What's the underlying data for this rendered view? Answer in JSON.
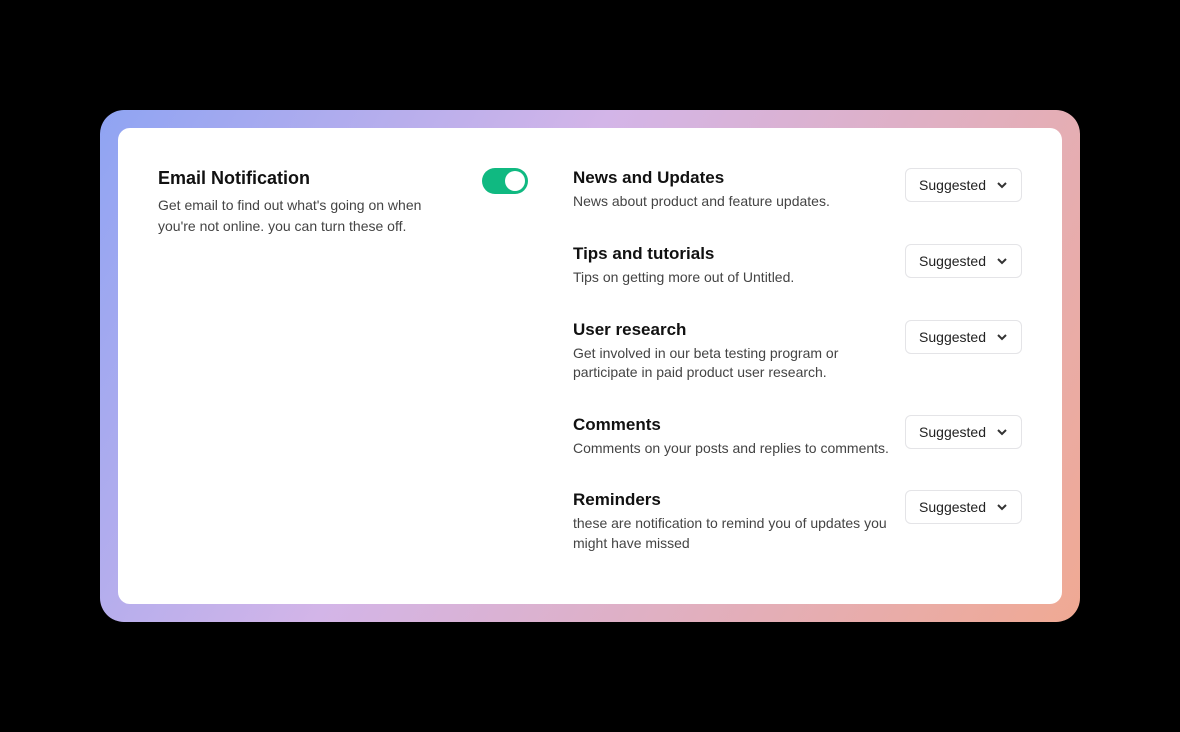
{
  "emailNotification": {
    "title": "Email Notification",
    "description": "Get email to find out what's going on when you're not online. you can turn these off.",
    "toggle": true
  },
  "settings": [
    {
      "title": "News and Updates",
      "description": "News about product and feature updates.",
      "dropdown": "Suggested"
    },
    {
      "title": "Tips and tutorials",
      "description": "Tips on getting more out of Untitled.",
      "dropdown": "Suggested"
    },
    {
      "title": "User research",
      "description": "Get involved in our beta testing program or participate in paid product user research.",
      "dropdown": "Suggested"
    },
    {
      "title": "Comments",
      "description": "Comments on your posts and replies to comments.",
      "dropdown": "Suggested"
    },
    {
      "title": "Reminders",
      "description": "these are notification to remind you of updates you might have missed",
      "dropdown": "Suggested"
    }
  ]
}
